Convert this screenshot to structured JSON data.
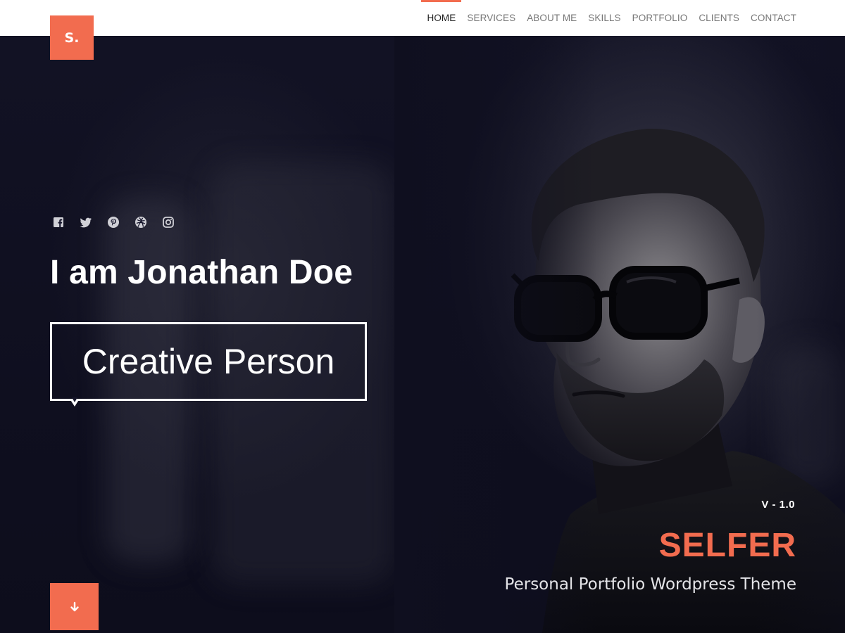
{
  "brand": {
    "logo_text": "S.",
    "accent_color": "#f26c4f"
  },
  "nav": {
    "items": [
      {
        "label": "HOME",
        "active": true
      },
      {
        "label": "SERVICES",
        "active": false
      },
      {
        "label": "ABOUT ME",
        "active": false
      },
      {
        "label": "SKILLS",
        "active": false
      },
      {
        "label": "PORTFOLIO",
        "active": false
      },
      {
        "label": "CLIENTS",
        "active": false
      },
      {
        "label": "CONTACT",
        "active": false
      }
    ]
  },
  "hero": {
    "social_icons": [
      "facebook-icon",
      "twitter-icon",
      "pinterest-icon",
      "dribbble-icon",
      "instagram-icon"
    ],
    "headline": "I am Jonathan Doe",
    "role": "Creative Person",
    "version": "V - 1.0",
    "title": "SELFER",
    "tagline": "Personal Portfolio Wordpress Theme",
    "scroll_icon": "arrow-down-icon"
  }
}
